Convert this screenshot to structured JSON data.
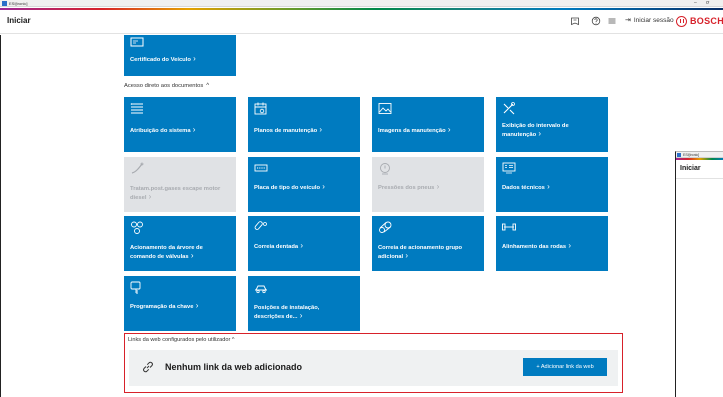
{
  "os": {
    "window_title": "ESI[tronic]",
    "min_glyph": "–",
    "restore_glyph": "ơ"
  },
  "header": {
    "title": "Iniciar",
    "login_label": "Iniciar sessão",
    "brand": "BOSCH",
    "icons": [
      "bookmark-icon",
      "help-icon",
      "menu-icon",
      "login-arrow-icon"
    ]
  },
  "tiles_top": [
    {
      "label": "Certificado do Veículo",
      "icon": "vehicle-certificate-icon",
      "enabled": true
    }
  ],
  "direct_access": {
    "label": "Acesso direto aos documentos",
    "tiles": [
      {
        "label": "Atribuição do sistema",
        "icon": "list-icon",
        "enabled": true
      },
      {
        "label": "Planos de manutenção",
        "icon": "calendar-gear-icon",
        "enabled": true
      },
      {
        "label": "Imagens da manutenção",
        "icon": "image-icon",
        "enabled": true
      },
      {
        "label": "Exibição do intervalo de manutenção",
        "icon": "tools-icon",
        "enabled": true
      },
      {
        "label": "Tratam.post.gases escape motor diesel",
        "icon": "exhaust-icon",
        "enabled": false
      },
      {
        "label": "Placa de tipo do veículo",
        "icon": "type-plate-icon",
        "enabled": true
      },
      {
        "label": "Pressões dos pneus",
        "icon": "tire-pressure-icon",
        "enabled": false
      },
      {
        "label": "Dados técnicos",
        "icon": "technical-data-icon",
        "enabled": true
      },
      {
        "label": "Acionamento da árvore de comando de válvulas",
        "icon": "camshaft-icon",
        "enabled": true
      },
      {
        "label": "Correia dentada",
        "icon": "timing-belt-icon",
        "enabled": true
      },
      {
        "label": "Correia de acionamento grupo adicional",
        "icon": "drive-belt-icon",
        "enabled": true
      },
      {
        "label": "Alinhamento das rodas",
        "icon": "wheel-alignment-icon",
        "enabled": true
      },
      {
        "label": "Programação da chave",
        "icon": "key-programming-icon",
        "enabled": true
      },
      {
        "label": "Posições de instalação, descrições de...",
        "icon": "installation-position-icon",
        "enabled": true
      }
    ]
  },
  "web_links": {
    "label": "Links da web configurados pelo utilizador",
    "empty_text": "Nenhum link da web adicionado",
    "add_button": "+ Adicionar link da web"
  },
  "side_window": {
    "window_title": "ESI[tronic]",
    "title": "Iniciar"
  },
  "colors": {
    "tile": "#007bc0",
    "tile_disabled": "#e0e2e5",
    "brand": "#d7212a",
    "panel_border": "#d7212a"
  }
}
